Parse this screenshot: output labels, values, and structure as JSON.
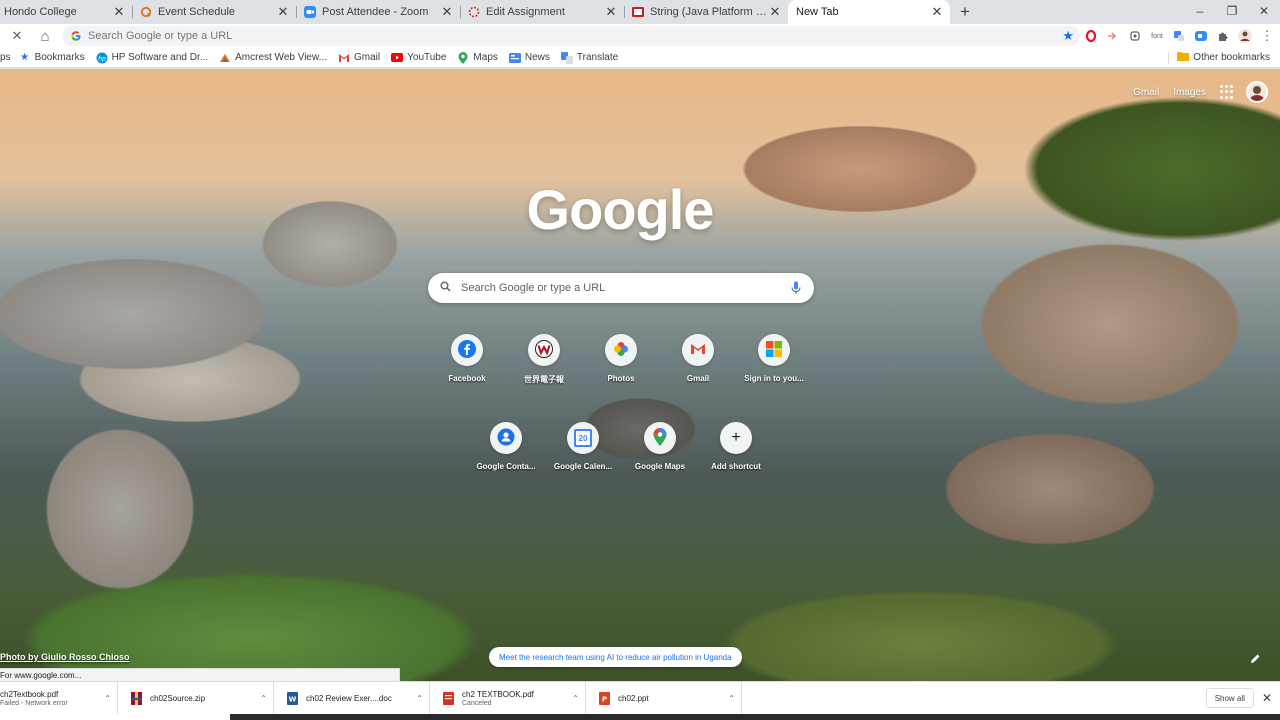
{
  "tabs": [
    {
      "title": "Hondo College",
      "favicon": "college-icon",
      "close": "✕"
    },
    {
      "title": "Event Schedule",
      "favicon": "orange-q-icon",
      "close": "✕"
    },
    {
      "title": "Post Attendee - Zoom",
      "favicon": "zoom-icon",
      "close": "✕"
    },
    {
      "title": "Edit Assignment",
      "favicon": "loading-icon",
      "close": "✕"
    },
    {
      "title": "String (Java Platform SE 8 )",
      "favicon": "java-doc-icon",
      "close": "✕"
    },
    {
      "title": "New Tab",
      "favicon": "",
      "close": "✕",
      "active": true
    }
  ],
  "new_tab_symbol": "+",
  "window_controls": {
    "minimize": "–",
    "maximize": "❐",
    "close": "✕"
  },
  "toolbar": {
    "stop_symbol": "✕",
    "home_symbol": "⌂",
    "omnibox_placeholder": "Search Google or type a URL",
    "star_symbol": "★",
    "extensions": [
      "opera-icon",
      "arrow-icon",
      "clip-icon",
      "font-icon",
      "translate-icon",
      "zoom-ext-icon",
      "puzzle-icon",
      "profile-icon",
      "menu-icon"
    ],
    "font_ext_label": "font",
    "menu_symbol": "⋮"
  },
  "bookmarks": {
    "items": [
      {
        "label": "ps",
        "icon": "apps-icon"
      },
      {
        "label": "Bookmarks",
        "icon": "star-icon"
      },
      {
        "label": "HP Software and Dr...",
        "icon": "hp-icon"
      },
      {
        "label": "Amcrest Web View...",
        "icon": "amcrest-icon"
      },
      {
        "label": "Gmail",
        "icon": "gmail-icon"
      },
      {
        "label": "YouTube",
        "icon": "youtube-icon"
      },
      {
        "label": "Maps",
        "icon": "maps-icon"
      },
      {
        "label": "News",
        "icon": "news-icon"
      },
      {
        "label": "Translate",
        "icon": "translate-icon"
      }
    ],
    "other": "Other bookmarks"
  },
  "ntp": {
    "gmail_link": "Gmail",
    "images_link": "Images",
    "logo": "Google",
    "search_placeholder": "Search Google or type a URL",
    "tiles_row1": [
      {
        "label": "Facebook",
        "icon": "facebook-icon"
      },
      {
        "label": "世界電子報",
        "icon": "w-icon"
      },
      {
        "label": "Photos",
        "icon": "photos-icon"
      },
      {
        "label": "Gmail",
        "icon": "gmail-icon"
      },
      {
        "label": "Sign in to you...",
        "icon": "microsoft-icon"
      }
    ],
    "tiles_row2": [
      {
        "label": "Google Conta...",
        "icon": "contacts-icon"
      },
      {
        "label": "Google Calen...",
        "icon": "calendar-icon"
      },
      {
        "label": "Google Maps",
        "icon": "maps-icon"
      },
      {
        "label": "Add shortcut",
        "icon": "plus-icon"
      }
    ],
    "calendar_day": "20",
    "add_symbol": "+",
    "attribution": "Photo by Giulio Rosso Chioso",
    "promo": "Meet the research team using AI to reduce air pollution in Uganda",
    "status_url": "For www.google.com..."
  },
  "downloads": [
    {
      "name": "ch2Textbook.pdf",
      "status": "Failed - Network error",
      "icon": "pdf-icon"
    },
    {
      "name": "ch02Source.zip",
      "status": "",
      "icon": "zip-icon"
    },
    {
      "name": "ch02 Review Exer....doc",
      "status": "",
      "icon": "doc-icon"
    },
    {
      "name": "ch2 TEXTBOOK.pdf",
      "status": "Canceled",
      "icon": "pdf-icon"
    },
    {
      "name": "ch02.ppt",
      "status": "",
      "icon": "ppt-icon"
    }
  ],
  "show_all": "Show all",
  "shelf_close": "✕",
  "chevron": "⌃",
  "colors": {
    "accent": "#1a73e8",
    "tab_bg": "#dee1e6"
  }
}
